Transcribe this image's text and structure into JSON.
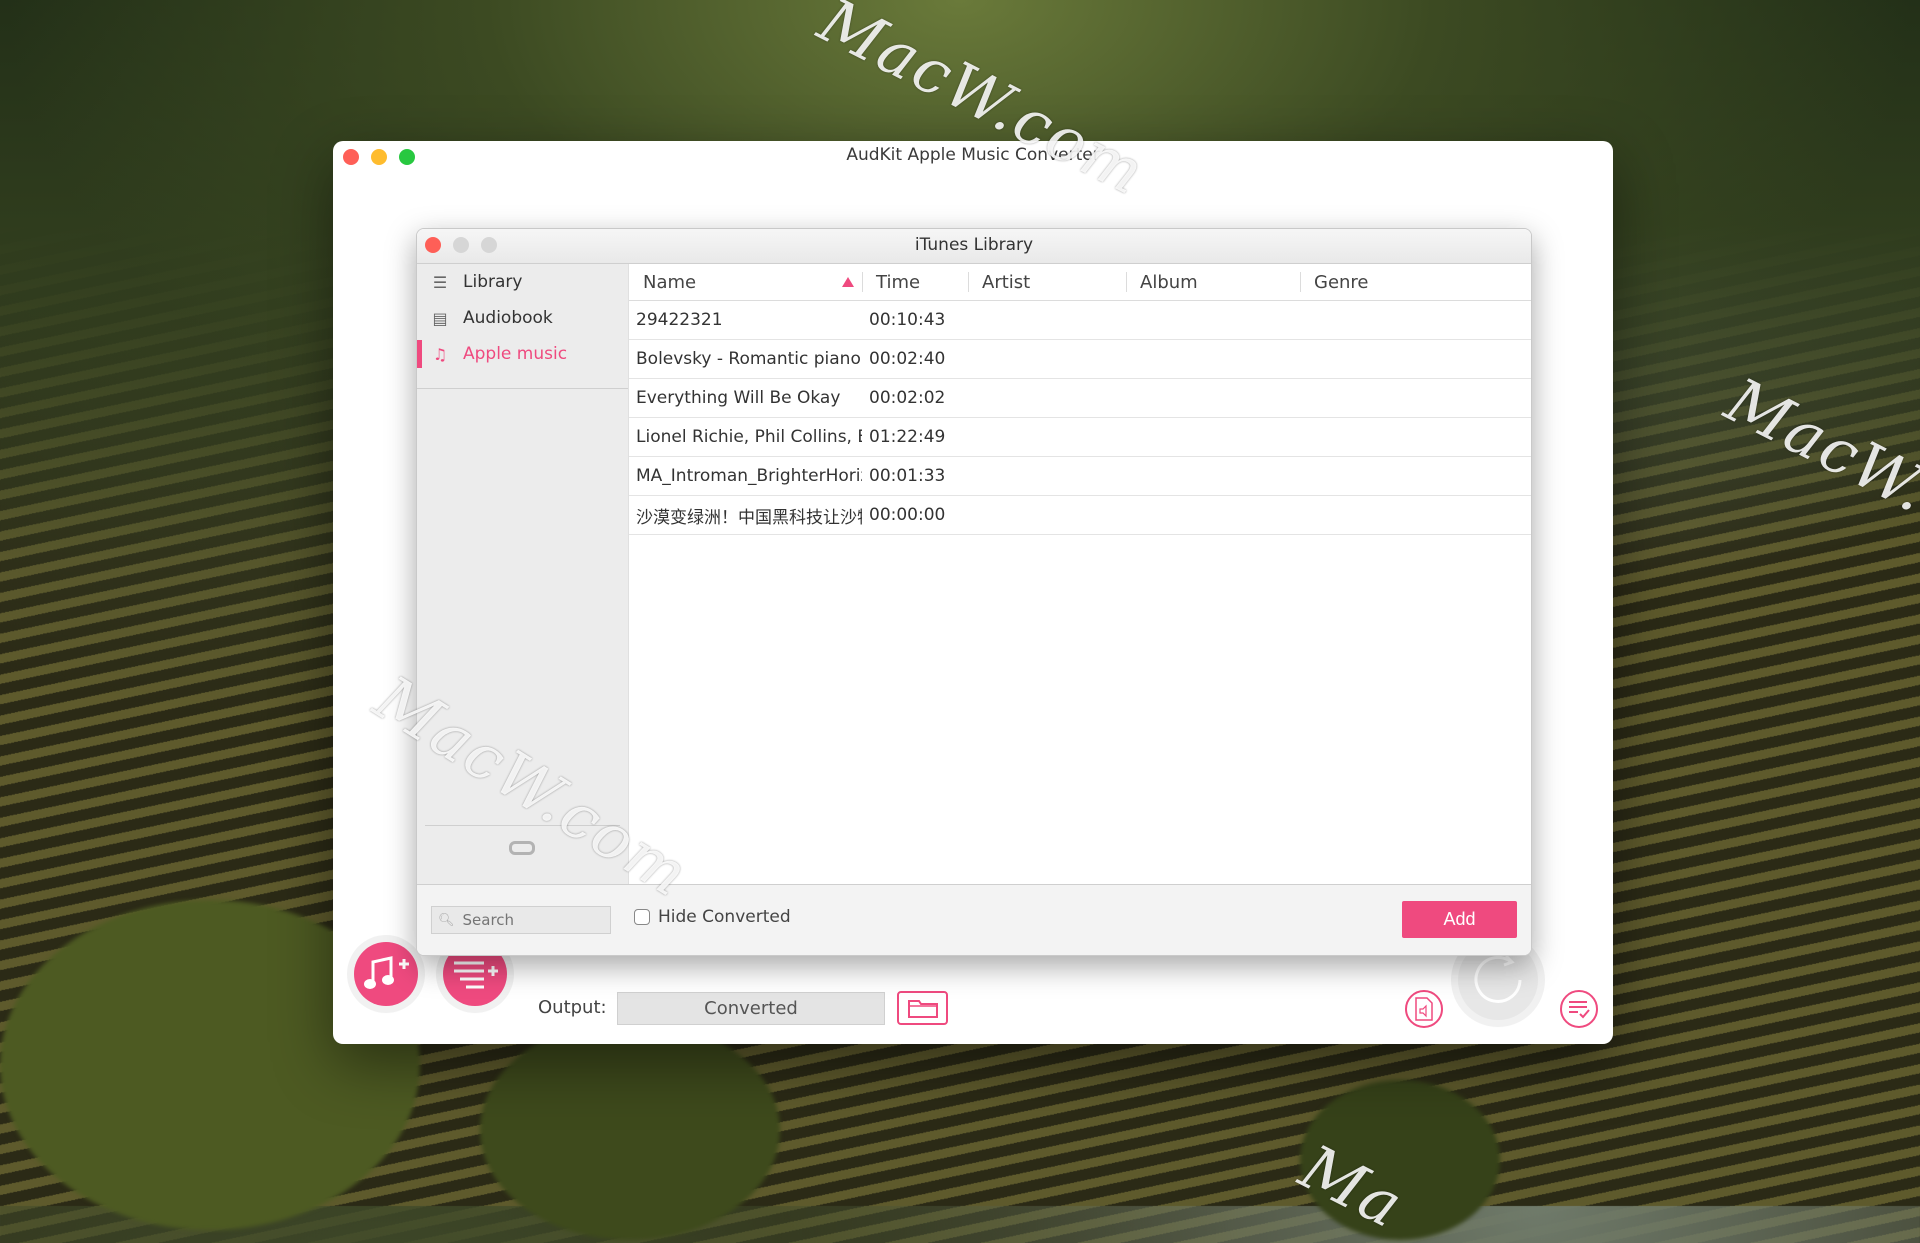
{
  "main_window": {
    "title": "AudKit Apple Music Converter"
  },
  "dialog": {
    "title": "iTunes Library",
    "sidebar": [
      {
        "label": "Library",
        "icon": "menu-icon"
      },
      {
        "label": "Audiobook",
        "icon": "book-icon"
      },
      {
        "label": "Apple music",
        "icon": "music-note-icon",
        "active": true
      }
    ],
    "columns": [
      "Name",
      "Time",
      "Artist",
      "Album",
      "Genre"
    ],
    "rows": [
      {
        "name": "29422321",
        "time": "00:10:43",
        "artist": "",
        "album": "",
        "genre": ""
      },
      {
        "name": "Bolevsky - Romantic piano",
        "time": "00:02:40",
        "artist": "",
        "album": "",
        "genre": ""
      },
      {
        "name": "Everything Will Be Okay",
        "time": "00:02:02",
        "artist": "",
        "album": "",
        "genre": ""
      },
      {
        "name": "Lionel Richie, Phil Collins, Elton ...",
        "time": "01:22:49",
        "artist": "",
        "album": "",
        "genre": ""
      },
      {
        "name": "MA_Introman_BrighterHorizons...",
        "time": "00:01:33",
        "artist": "",
        "album": "",
        "genre": ""
      },
      {
        "name": "沙漠变绿洲！中国黑科技让沙特...",
        "time": "00:00:00",
        "artist": "",
        "album": "",
        "genre": ""
      }
    ],
    "search_placeholder": "Search",
    "hide_converted_label": "Hide Converted",
    "hide_converted_checked": false,
    "add_label": "Add"
  },
  "toolbar": {
    "output_label": "Output:",
    "output_value": "Converted"
  },
  "watermarks": [
    "MacW.com",
    "MacW.com",
    "MacW.com",
    "Ma"
  ],
  "colors": {
    "accent": "#ef4a7f",
    "close": "#fe5f57",
    "minimize": "#febc2e",
    "zoom": "#28c840",
    "inactive_light": "#d6d6d6"
  }
}
